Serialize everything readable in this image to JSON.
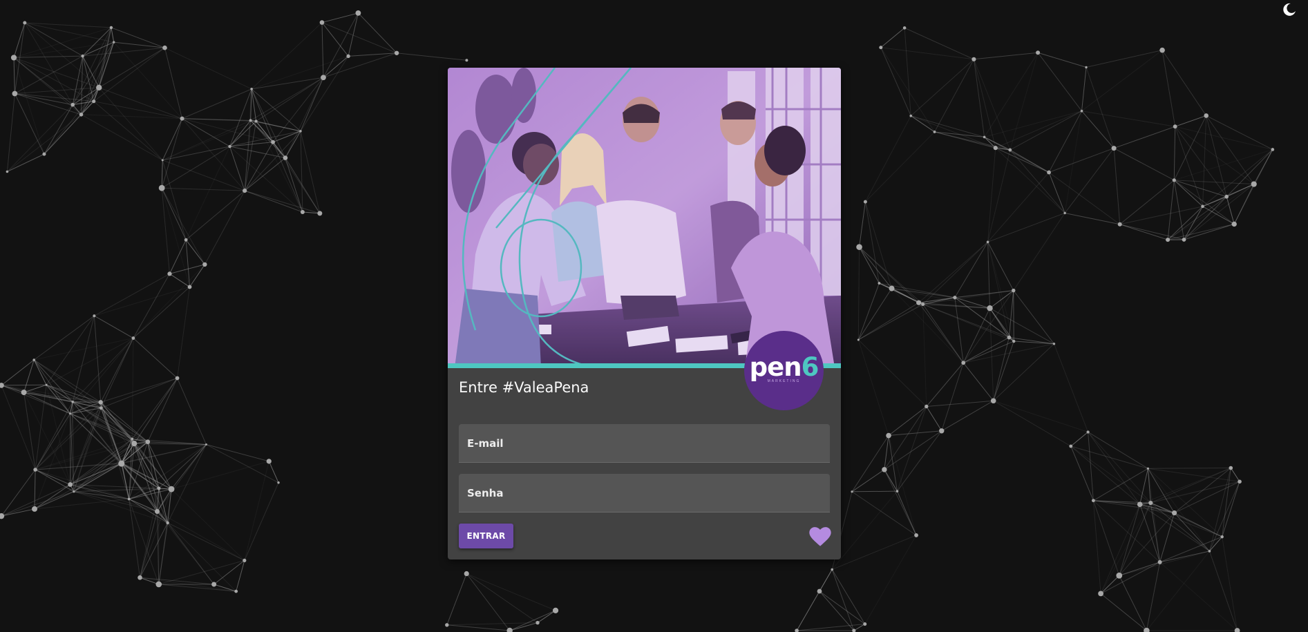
{
  "theme_toggle": {
    "icon": "moon-icon"
  },
  "login_card": {
    "hero_image": {
      "description_icon": "team-photo"
    },
    "brand": {
      "name_main": "pen",
      "name_accent": "6",
      "tagline": "MARKETING"
    },
    "title": "Entre #ValeaPena",
    "email": {
      "placeholder": "E-mail",
      "value": ""
    },
    "password": {
      "placeholder": "Senha",
      "value": ""
    },
    "submit_label": "ENTRAR",
    "favorite": {
      "icon": "heart-icon"
    }
  },
  "colors": {
    "background": "#121212",
    "card": "#424242",
    "field": "#555555",
    "button": "#6d4aa8",
    "accent_teal": "#4ec7c1",
    "brand_purple": "#5a2e8a",
    "heart": "#b48be0"
  }
}
